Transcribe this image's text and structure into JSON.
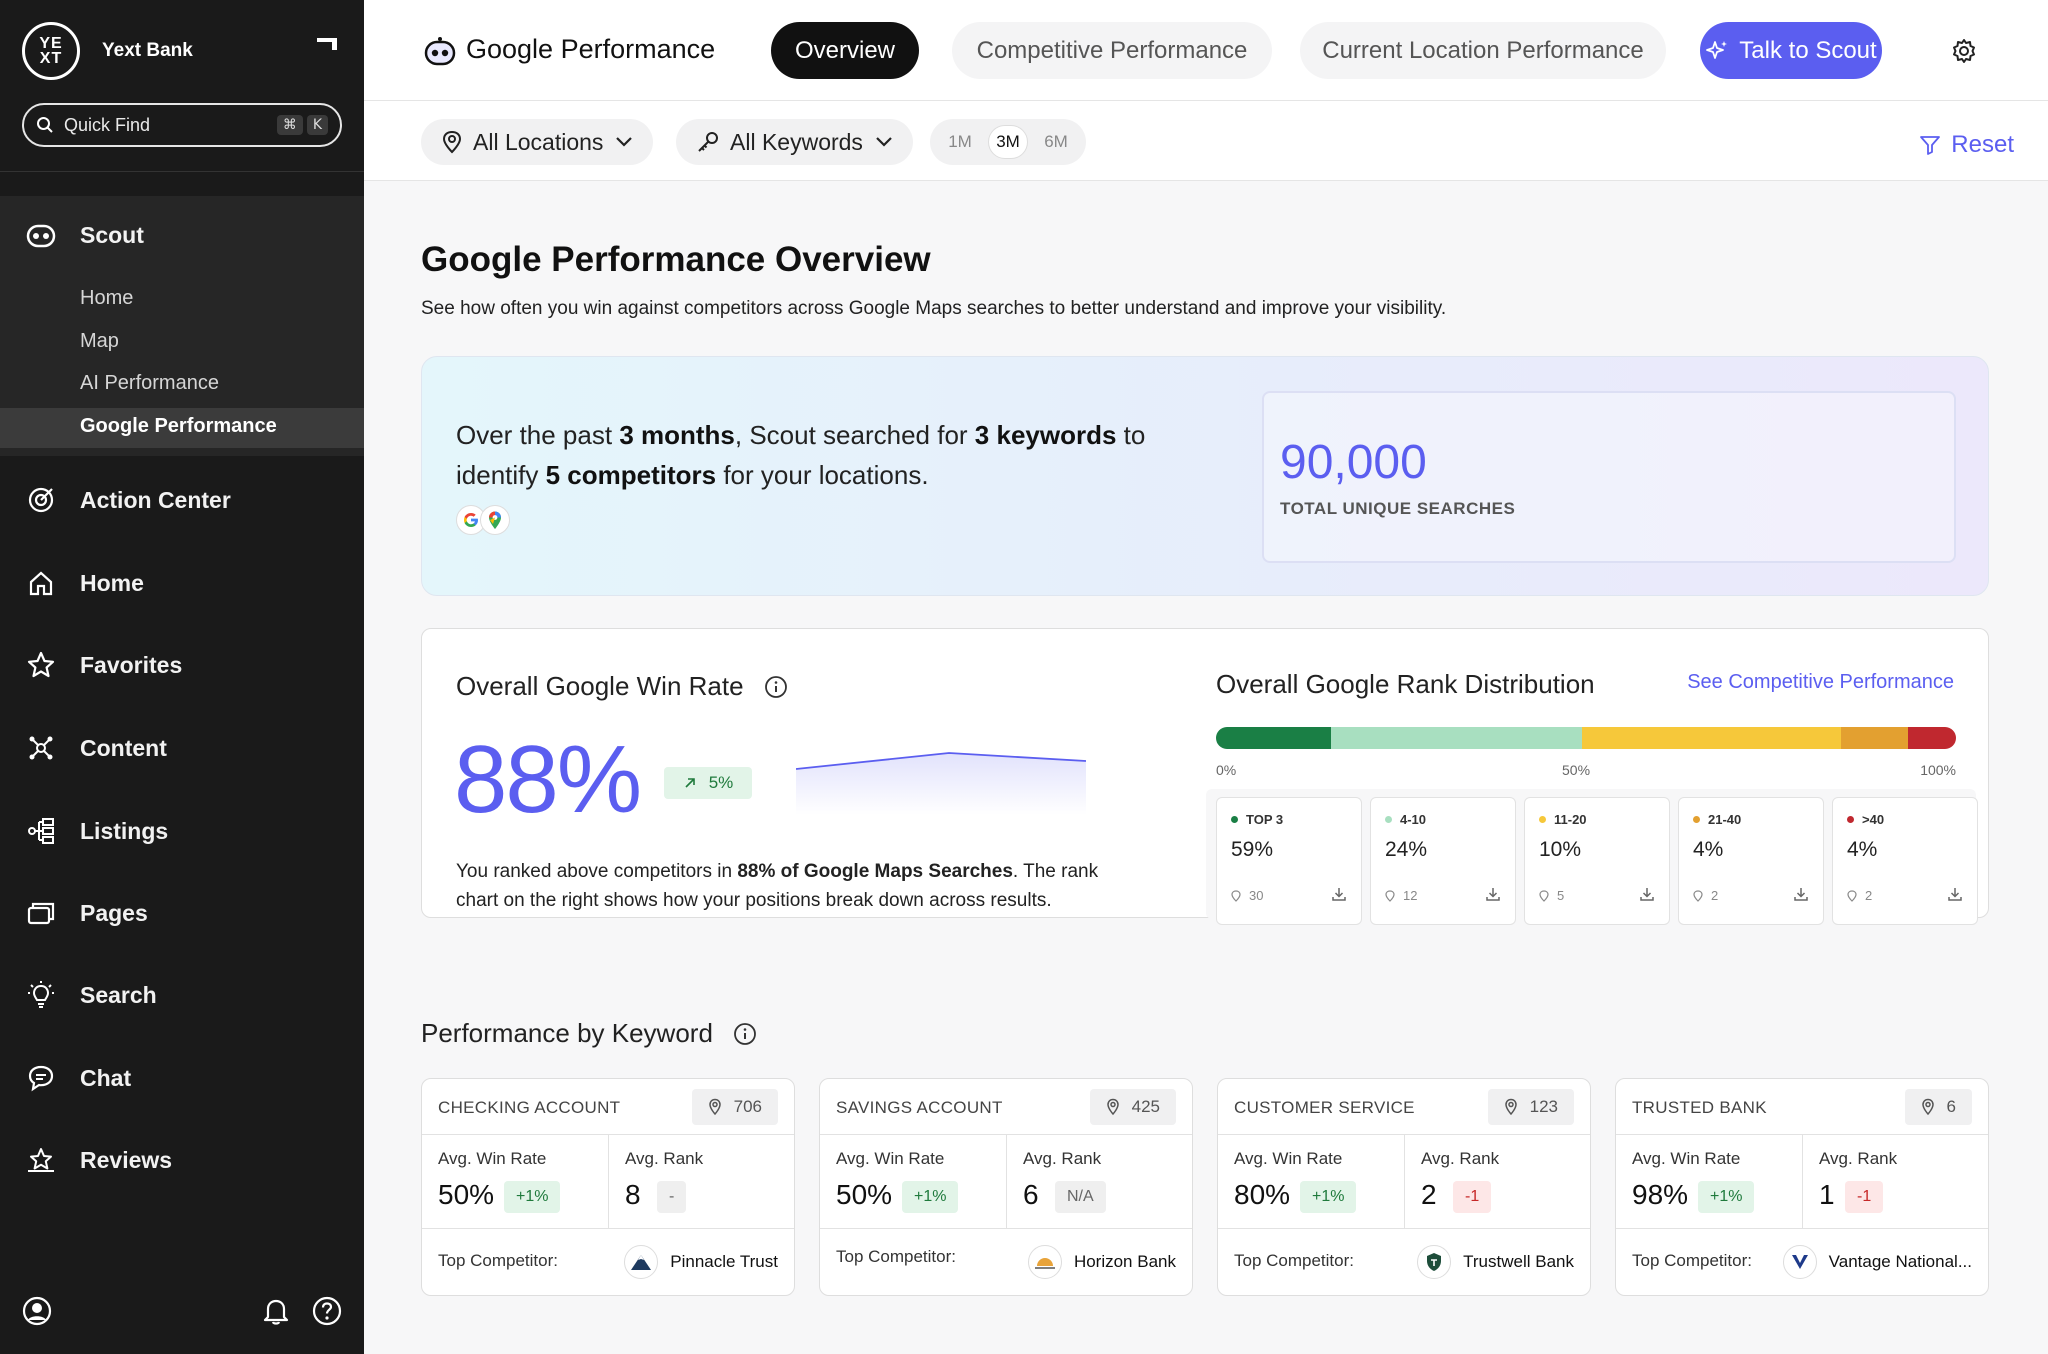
{
  "sidebar": {
    "brand_logo_text": "YEXT",
    "brand_name": "Yext Bank",
    "quick_find": {
      "label": "Quick Find",
      "key_cmd": "⌘",
      "key_k": "K"
    },
    "scout": {
      "label": "Scout",
      "icon": "robot-icon",
      "sub_items": [
        {
          "label": "Home"
        },
        {
          "label": "Map"
        },
        {
          "label": "AI Performance"
        },
        {
          "label": "Google Performance",
          "active": true
        }
      ]
    },
    "items": [
      {
        "label": "Action Center",
        "icon": "target-icon"
      },
      {
        "label": "Home",
        "icon": "home-icon"
      },
      {
        "label": "Favorites",
        "icon": "star-icon"
      },
      {
        "label": "Content",
        "icon": "network-icon"
      },
      {
        "label": "Listings",
        "icon": "listings-icon"
      },
      {
        "label": "Pages",
        "icon": "pages-icon"
      },
      {
        "label": "Search",
        "icon": "lightbulb-icon"
      },
      {
        "label": "Chat",
        "icon": "chat-icon"
      },
      {
        "label": "Reviews",
        "icon": "stars-icon"
      }
    ]
  },
  "header": {
    "title": "Google Performance",
    "tabs": [
      {
        "label": "Overview",
        "active": true
      },
      {
        "label": "Competitive Performance"
      },
      {
        "label": "Current Location Performance"
      }
    ],
    "scout_button": "Talk to Scout"
  },
  "filters": {
    "locations": "All Locations",
    "keywords": "All Keywords",
    "ranges": [
      "1M",
      "3M",
      "6M"
    ],
    "selected_range": "3M",
    "reset": "Reset"
  },
  "overview": {
    "title": "Google Performance Overview",
    "description": "See how often you win against competitors across Google Maps searches to better understand and improve your visibility.",
    "summary": {
      "pre": "Over the past ",
      "period": "3 months",
      "mid1": ", Scout searched for ",
      "keywords": "3 keywords",
      "mid2": " to identify ",
      "competitors": "5 competitors",
      "post": " for your locations."
    },
    "total_searches": {
      "value": "90,000",
      "label": "TOTAL UNIQUE SEARCHES"
    }
  },
  "win_rate": {
    "title": "Overall Google Win Rate",
    "value": "88%",
    "delta": "5%",
    "desc_pre": "You ranked above competitors in ",
    "desc_bold": "88% of Google Maps Searches",
    "desc_post": ". The rank chart on the right shows how your positions break down across results."
  },
  "rank_distribution": {
    "title": "Overall Google Rank Distribution",
    "link": "See Competitive Performance",
    "ticks": [
      "0%",
      "50%",
      "100%"
    ],
    "buckets": [
      {
        "label": "TOP 3",
        "pct": "59%",
        "count": "30",
        "color": "#1a7f45",
        "share": 0.155
      },
      {
        "label": "4-10",
        "pct": "24%",
        "count": "12",
        "color": "#a8dfc0",
        "share": 0.34
      },
      {
        "label": "11-20",
        "pct": "10%",
        "count": "5",
        "color": "#f6c83a",
        "share": 0.35
      },
      {
        "label": "21-40",
        "pct": "4%",
        "count": "2",
        "color": "#e3a030",
        "share": 0.09
      },
      {
        "label": ">40",
        "pct": "4%",
        "count": "2",
        "color": "#c0282f",
        "share": 0.065
      }
    ]
  },
  "keywords": {
    "title": "Performance by Keyword",
    "win_rate_label": "Avg. Win Rate",
    "rank_label": "Avg. Rank",
    "competitor_label": "Top Competitor:",
    "cards": [
      {
        "name": "CHECKING ACCOUNT",
        "count": "706",
        "win_rate": "50%",
        "win_delta": "+1%",
        "rank": "8",
        "rank_delta": "-",
        "rank_style": "gray",
        "competitor": "Pinnacle Trust",
        "logo": "mountain-icon"
      },
      {
        "name": "SAVINGS ACCOUNT",
        "count": "425",
        "win_rate": "50%",
        "win_delta": "+1%",
        "rank": "6",
        "rank_delta": "N/A",
        "rank_style": "gray",
        "competitor": "Horizon Bank",
        "logo": "sunrise-icon"
      },
      {
        "name": "CUSTOMER SERVICE",
        "count": "123",
        "win_rate": "80%",
        "win_delta": "+1%",
        "rank": "2",
        "rank_delta": "-1",
        "rank_style": "red",
        "competitor": "Trustwell Bank",
        "logo": "shield-icon"
      },
      {
        "name": "TRUSTED BANK",
        "count": "6",
        "win_rate": "98%",
        "win_delta": "+1%",
        "rank": "1",
        "rank_delta": "-1",
        "rank_style": "red",
        "competitor": "Vantage National...",
        "logo": "v-icon"
      }
    ]
  },
  "colors": {
    "accent": "#5b5ef0",
    "sidebar": "#1a1a1a"
  }
}
